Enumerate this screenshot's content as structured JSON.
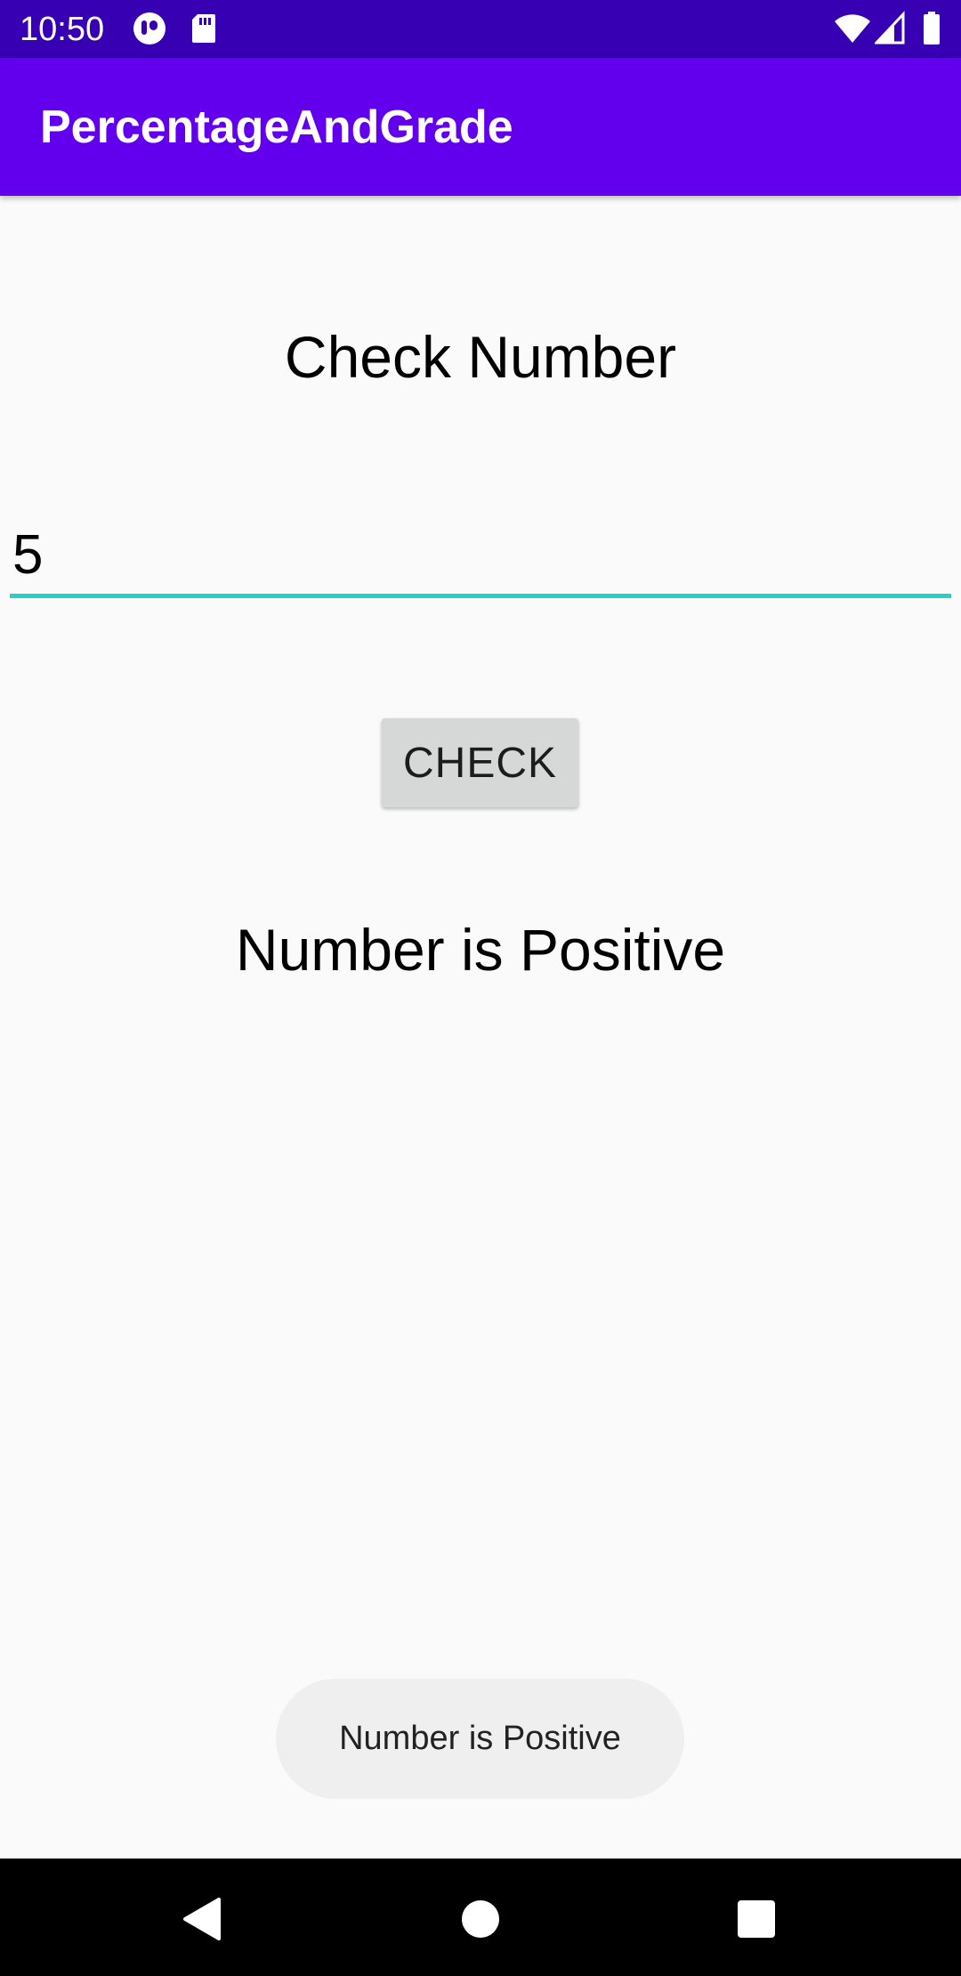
{
  "status_bar": {
    "time": "10:50",
    "icons": [
      "app-notification-icon",
      "sd-card-icon",
      "wifi-icon",
      "cell-signal-icon",
      "battery-icon"
    ]
  },
  "app_bar": {
    "title": "PercentageAndGrade"
  },
  "main": {
    "heading": "Check Number",
    "number_input_value": "5",
    "check_button_label": "CHECK",
    "result_text": "Number is Positive"
  },
  "toast": {
    "message": "Number is Positive"
  },
  "nav_bar": {
    "buttons": [
      "back-icon",
      "home-icon",
      "recents-icon"
    ]
  },
  "colors": {
    "status_bar": "#3700b3",
    "app_bar": "#6200ee",
    "input_underline": "#26d0c6",
    "button_bg": "#d6d7d7",
    "toast_bg": "#efefef"
  }
}
